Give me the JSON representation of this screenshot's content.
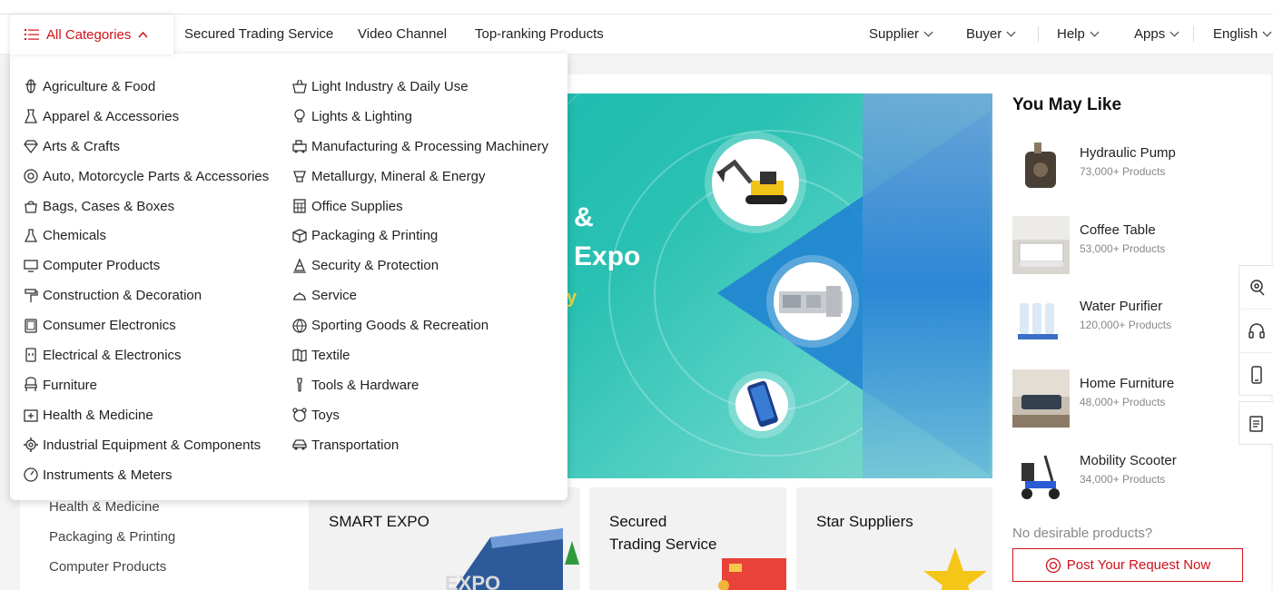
{
  "nav": {
    "all_categories": "All Categories",
    "links": [
      "Secured Trading Service",
      "Video Channel",
      "Top-ranking Products"
    ],
    "right": [
      "Supplier",
      "Buyer",
      "Help",
      "Apps",
      "English"
    ]
  },
  "dropdown": {
    "left": [
      "Agriculture & Food",
      "Apparel & Accessories",
      "Arts & Crafts",
      "Auto, Motorcycle Parts & Accessories",
      "Bags, Cases & Boxes",
      "Chemicals",
      "Computer Products",
      "Construction & Decoration",
      "Consumer Electronics",
      "Electrical & Electronics",
      "Furniture",
      "Health & Medicine",
      "Industrial Equipment & Components",
      "Instruments & Meters"
    ],
    "right": [
      "Light Industry & Daily Use",
      "Lights & Lighting",
      "Manufacturing & Processing Machinery",
      "Metallurgy, Mineral & Energy",
      "Office Supplies",
      "Packaging & Printing",
      "Security & Protection",
      "Service",
      "Sporting Goods & Recreation",
      "Textile",
      "Tools & Hardware",
      "Toys",
      "Transportation"
    ]
  },
  "left_categories": [
    "Health & Medicine",
    "Packaging & Printing",
    "Computer Products"
  ],
  "banner": {
    "amp": "&",
    "expo": "Expo",
    "y": "y"
  },
  "cards": [
    {
      "title": "SMART EXPO"
    },
    {
      "title_line1": "Secured",
      "title_line2": "Trading Service"
    },
    {
      "title": "Star Suppliers"
    }
  ],
  "you_may_like": {
    "title": "You May Like",
    "items": [
      {
        "name": "Hydraulic Pump",
        "count": "73,000+ Products"
      },
      {
        "name": "Coffee Table",
        "count": "53,000+ Products"
      },
      {
        "name": "Water Purifier",
        "count": "120,000+ Products"
      },
      {
        "name": "Home Furniture",
        "count": "48,000+ Products"
      },
      {
        "name": "Mobility Scooter",
        "count": "34,000+ Products"
      }
    ],
    "no_desirable": "No desirable products?",
    "post_button": "Post Your Request Now"
  },
  "colors": {
    "brand_red": "#d0121b",
    "banner_teal": "#17b7ad",
    "banner_blue": "#1f7fd4"
  }
}
